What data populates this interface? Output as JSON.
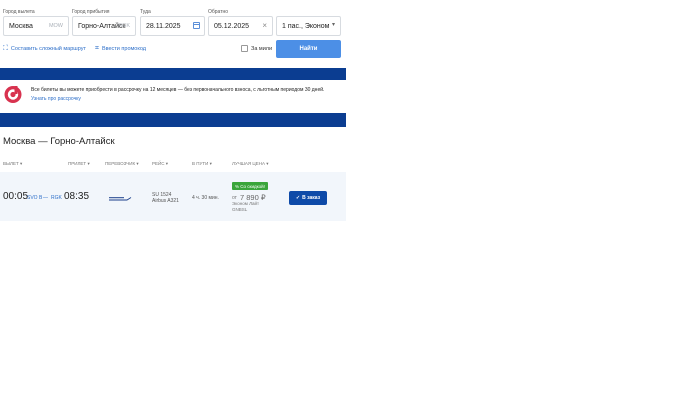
{
  "search": {
    "from_label": "Город вылета",
    "from_value": "Москва",
    "from_code": "MOW",
    "to_label": "Город прибытия",
    "to_value": "Горно-Алтайск",
    "to_code": "RGK",
    "depart_label": "Туда",
    "depart_value": "28.11.2025",
    "return_label": "Обратно",
    "return_value": "05.12.2025",
    "passengers_value": "1 пас., Эконом",
    "complex_route_link": "Составить сложный маршрут",
    "promo_link": "Ввести промокод",
    "miles_label": "За мили",
    "find_button": "Найти"
  },
  "banner": {
    "text": "Все билеты вы можете приобрести в рассрочку на 12 месяцев — без первоначального взноса, с льготным периодом 30 дней.",
    "link": "Узнать про рассрочку"
  },
  "results": {
    "route_title": "Москва — Горно-Алтайск",
    "columns": [
      "ВЫЛЕТ",
      "ПРИЛЕТ",
      "ПЕРЕВОЗЧИК",
      "РЕЙС",
      "В ПУТИ",
      "ЛУЧШАЯ ЦЕНА"
    ],
    "flight": {
      "depart_time": "00:05",
      "depart_airport": "SVO B",
      "arrive_airport": "RGK",
      "arrive_time": "08:35",
      "flight_number": "SU 1524",
      "aircraft": "Airbus A321",
      "duration": "4 ч. 30 мин.",
      "discount_badge": "% Со скидкой!",
      "price_prefix": "от",
      "price": "7 890 ₽",
      "fare_name": "Эконом Лайт",
      "fare_code": "GNBSL",
      "order_button": "В заказ"
    }
  },
  "colors": {
    "accent": "#4c8fe6",
    "brand_dark": "#0b3d91",
    "order_button": "#0e4aa8",
    "discount": "#3aa53a",
    "logo_red": "#d8324f"
  }
}
